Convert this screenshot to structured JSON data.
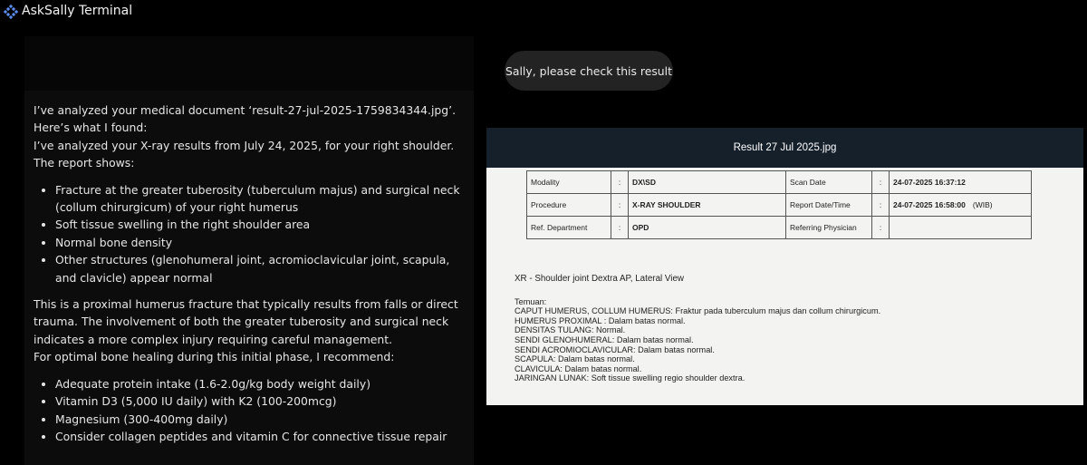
{
  "app": {
    "title": "AskSally Terminal"
  },
  "user_message": "Sally, please check this result",
  "assistant": {
    "intro1": "I’ve analyzed your medical document ‘result-27-jul-2025-1759834344.jpg’. Here’s what I found:",
    "intro2": "I’ve analyzed your X-ray results from July 24, 2025, for your right shoulder. The report shows:",
    "findings": [
      "Fracture at the greater tuberosity (tuberculum majus) and surgical neck (collum chirurgicum) of your right humerus",
      "Soft tissue swelling in the right shoulder area",
      "Normal bone density",
      "Other structures (glenohumeral joint, acromioclavicular joint, scapula, and clavicle) appear normal"
    ],
    "para1": "This is a proximal humerus fracture that typically results from falls or direct trauma. The involvement of both the greater tuberosity and surgical neck indicates a more complex injury requiring careful management.",
    "para2": "For optimal bone healing during this initial phase, I recommend:",
    "recs": [
      "Adequate protein intake (1.6-2.0g/kg body weight daily)",
      "Vitamin D3 (5,000 IU daily) with K2 (100-200mcg)",
      "Magnesium (300-400mg daily)",
      "Consider collagen peptides and vitamin C for connective tissue repair"
    ]
  },
  "attachment": {
    "filename": "Result 27 Jul 2025.jpg",
    "table": {
      "rows": [
        {
          "l1": "Modality",
          "v1": "DX\\SD",
          "l2": "Scan Date",
          "v2": "24-07-2025 16:37:12",
          "extra": ""
        },
        {
          "l1": "Procedure",
          "v1": "X-RAY SHOULDER",
          "l2": "Report Date/Time",
          "v2": "24-07-2025 16:58:00",
          "extra": "(WIB)"
        },
        {
          "l1": "Ref. Department",
          "v1": "OPD",
          "l2": "Referring Physician",
          "v2": "",
          "extra": ""
        }
      ],
      "sep": ":"
    },
    "view": "XR - Shoulder joint Dextra AP, Lateral View",
    "report_lines": [
      "Temuan:",
      "CAPUT HUMERUS, COLLUM HUMERUS: Fraktur pada tuberculum majus dan collum chirurgicum.",
      "HUMERUS PROXIMAL : Dalam batas normal.",
      "DENSITAS TULANG: Normal.",
      "SENDI GLENOHUMERAL: Dalam batas normal.",
      "SENDI ACROMIOCLAVICULAR: Dalam batas normal.",
      "SCAPULA: Dalam batas normal.",
      "CLAVICULA: Dalam batas normal.",
      "JARINGAN LUNAK: Soft tissue swelling regio shoulder dextra."
    ]
  },
  "colors": {
    "logo": "#5b8def",
    "header": "#15202b",
    "bubble": "#232323"
  }
}
